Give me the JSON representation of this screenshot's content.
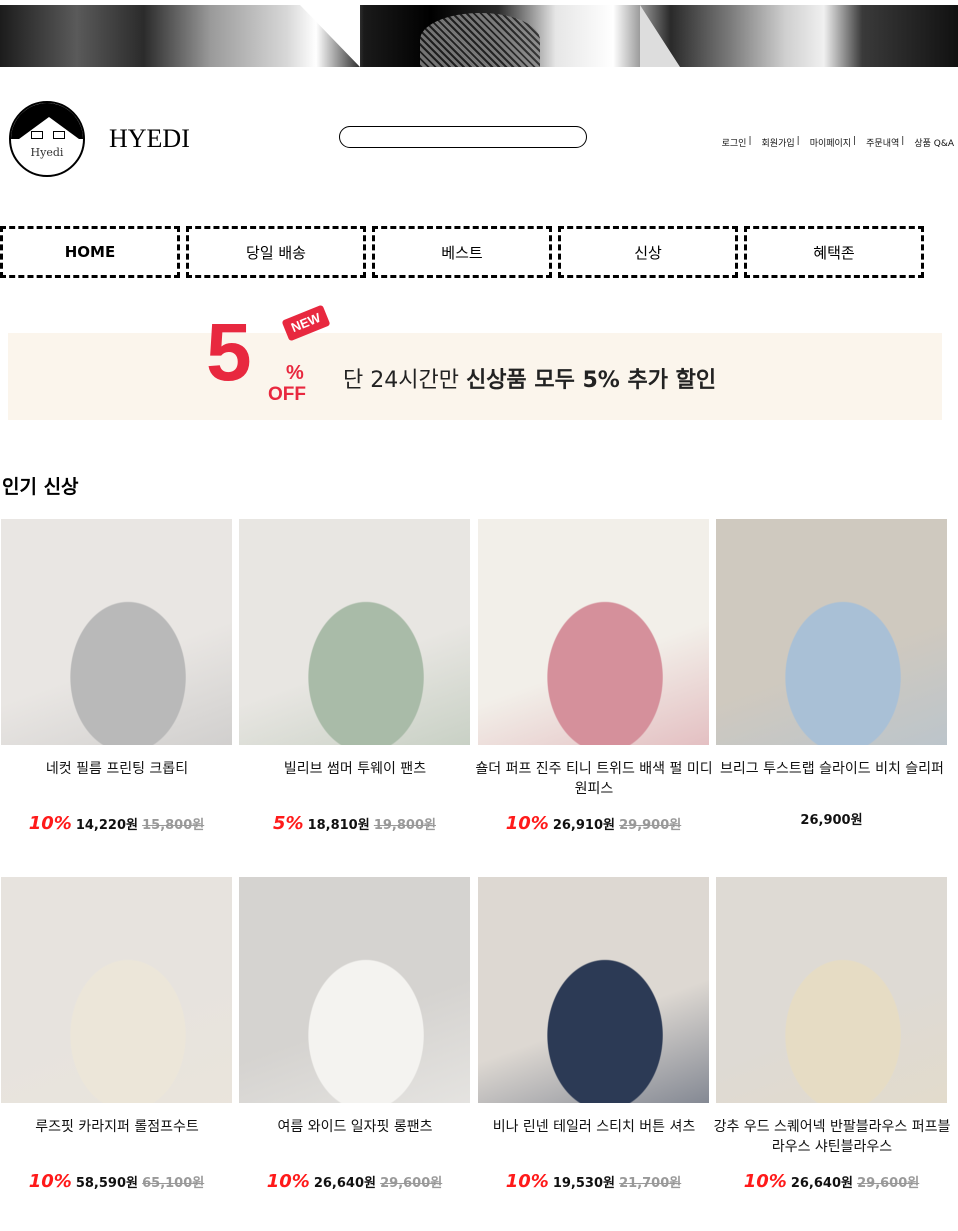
{
  "header": {
    "brand": "HYEDI",
    "logo_text": "Hyedi",
    "search_placeholder": "",
    "top_links": [
      "로그인",
      "회원가입",
      "마이페이지",
      "주문내역",
      "상품 Q&A"
    ],
    "separator": "|"
  },
  "nav": [
    "HOME",
    "당일 배송",
    "베스트",
    "신상",
    "혜택존"
  ],
  "promo": {
    "number": "5",
    "percent": "%",
    "off": "OFF",
    "badge": "NEW",
    "text_prefix": "단 24시간만 ",
    "text_bold": "신상품 모두 5% 추가 할인",
    "colors": {
      "accent": "#e8283f",
      "background": "#fbf5ec"
    }
  },
  "section_title": "인기 신상",
  "products": [
    {
      "name": "네컷 필름 프린팅 크롭티",
      "discount": "10%",
      "price": "14,220원",
      "original": "15,800원",
      "image": "woman in white crop tee with grey sweatpants",
      "colors": [
        "#e9e6e3",
        "#b9b9b9"
      ]
    },
    {
      "name": "빌리브 썸머 투웨이 팬츠",
      "discount": "5%",
      "price": "18,810원",
      "original": "19,800원",
      "image": "mint wide pants with wooden cabinet",
      "colors": [
        "#e8e6e2",
        "#a9bba8"
      ]
    },
    {
      "name": "숄더 퍼프 진주 티니 트위드 배색 펄 미디 원피스",
      "discount": "10%",
      "price": "26,910원",
      "original": "29,900원",
      "image": "pink tweed midi dress",
      "colors": [
        "#f2efe9",
        "#d5909b"
      ]
    },
    {
      "name": "브리그 투스트랩 슬라이드 비치 슬리퍼",
      "discount": "",
      "price": "26,900원",
      "original": "",
      "image": "white two-strap slides with jeans",
      "colors": [
        "#cfc9bf",
        "#a9c0d6"
      ]
    },
    {
      "name": "루즈핏 카라지퍼 롤점프수트",
      "discount": "10%",
      "price": "58,590원",
      "original": "65,100원",
      "image": "ivory collared jumpsuit",
      "colors": [
        "#e7e3de",
        "#ece6d9"
      ]
    },
    {
      "name": "여름 와이드 일자핏 롱팬츠",
      "discount": "10%",
      "price": "26,640원",
      "original": "29,600원",
      "image": "white wide straight pants",
      "colors": [
        "#d5d3d0",
        "#f4f3f0"
      ]
    },
    {
      "name": "비나 린넨 테일러 스티치 버튼 셔츠",
      "discount": "10%",
      "price": "19,530원",
      "original": "21,700원",
      "image": "navy linen shirt with contrast stitch",
      "colors": [
        "#ddd8d2",
        "#2c3a55"
      ]
    },
    {
      "name": "강추 우드 스퀘어넥 반팔블라우스 퍼프블라우스 샤틴블라우스",
      "discount": "10%",
      "price": "26,640원",
      "original": "29,600원",
      "image": "beige puff-sleeve blouse with black skirt",
      "colors": [
        "#dedad4",
        "#e6dcc4"
      ]
    }
  ]
}
